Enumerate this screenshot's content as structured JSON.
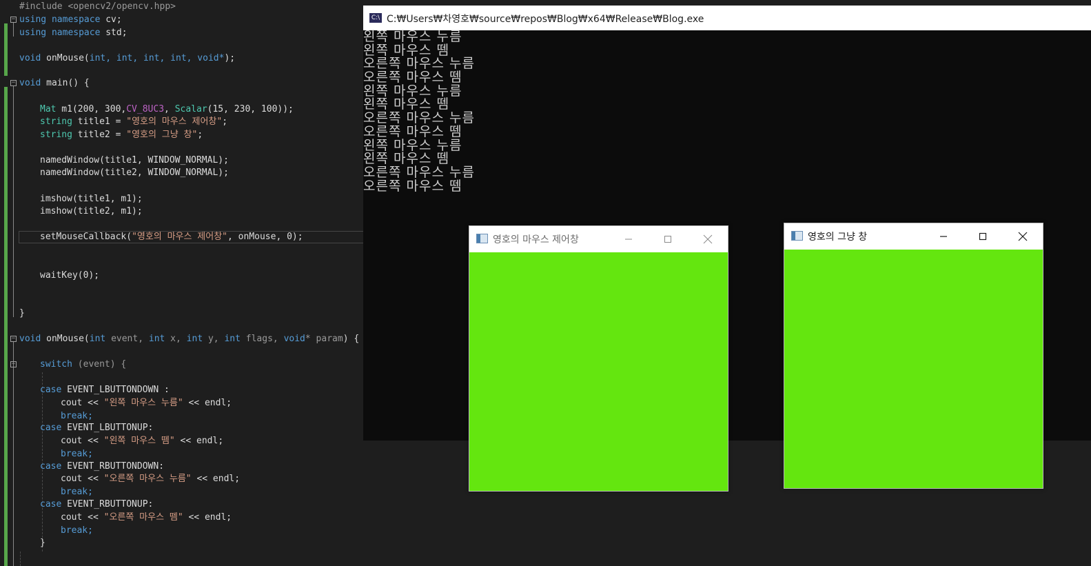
{
  "editor": {
    "lines": {
      "l01": "#include <opencv2/opencv.hpp>",
      "l02_kw": "using namespace",
      "l02_id": " cv;",
      "l03_kw": "using namespace",
      "l03_id": " std;",
      "l05_kw": "void",
      "l05_fn": " onMouse(",
      "l05_params": "int, int, int, int, void*",
      "l05_end": ");",
      "l07_kw": "void",
      "l07_rest": " main() {",
      "l09_ty": "Mat",
      "l09_a": " m1(200, 300,",
      "l09_mac": "CV_8UC3",
      "l09_b": ", ",
      "l09_ty2": "Scalar",
      "l09_c": "(15, 230, 100));",
      "l10_ty": "string",
      "l10_a": " title1 = ",
      "l10_str": "\"영호의 마우스 제어창\"",
      "l10_end": ";",
      "l11_ty": "string",
      "l11_a": " title2 = ",
      "l11_str": "\"영호의 그냥 창\"",
      "l11_end": ";",
      "l13": "namedWindow(title1, WINDOW_NORMAL);",
      "l14": "namedWindow(title2, WINDOW_NORMAL);",
      "l16": "imshow(title1, m1);",
      "l17": "imshow(title2, m1);",
      "l19_a": "setMouseCallback(",
      "l19_str": "\"영호의 마우스 제어창\"",
      "l19_b": ", onMouse, 0);",
      "l22": "waitKey(0);",
      "l25": "}",
      "l27_kw": "void",
      "l27_fn": " onMouse(",
      "l27_k1": "int",
      "l27_p1": " event, ",
      "l27_k2": "int",
      "l27_p2": " x, ",
      "l27_k3": "int",
      "l27_p3": " y, ",
      "l27_k4": "int",
      "l27_p4": " flags, ",
      "l27_k5": "void",
      "l27_p5": "* param",
      "l27_end": ") {",
      "l29_kw": "switch",
      "l29_rest": " (event) {",
      "c1_kw": "case",
      "c1_id": " EVENT_LBUTTONDOWN :",
      "c1_a": "cout << ",
      "c1_str": "\"왼쪽 마우스 누름\"",
      "c1_b": " << endl;",
      "c1_break": "break;",
      "c2_kw": "case",
      "c2_id": " EVENT_LBUTTONUP:",
      "c2_a": "cout << ",
      "c2_str": "\"왼쪽 마우스 뗌\"",
      "c2_b": " << endl;",
      "c2_break": "break;",
      "c3_kw": "case",
      "c3_id": " EVENT_RBUTTONDOWN:",
      "c3_a": "cout << ",
      "c3_str": "\"오른쪽 마우스 누름\"",
      "c3_b": " << endl;",
      "c3_break": "break;",
      "c4_kw": "case",
      "c4_id": " EVENT_RBUTTONUP:",
      "c4_a": "cout << ",
      "c4_str": "\"오른쪽 마우스 뗌\"",
      "c4_b": " << endl;",
      "c4_break": "break;",
      "close": "}"
    }
  },
  "console": {
    "title": "C:₩Users₩차영호₩source₩repos₩Blog₩x64₩Release₩Blog.exe",
    "icon_text": "C:\\",
    "output": [
      "왼쪽 마우스 누름",
      "왼쪽 마우스 뗌",
      "오른쪽 마우스 누름",
      "오른쪽 마우스 뗌",
      "왼쪽 마우스 누름",
      "왼쪽 마우스 뗌",
      "오른쪽 마우스 누름",
      "오른쪽 마우스 뗌",
      "왼쪽 마우스 누름",
      "왼쪽 마우스 뗌",
      "오른쪽 마우스 누름",
      "오른쪽 마우스 뗌"
    ]
  },
  "windows": {
    "control": {
      "title": "영호의 마우스 제어창",
      "title_color": "#6b6b6b",
      "canvas_color": "#64e60f"
    },
    "plain": {
      "title": "영호의 그냥 창",
      "title_color": "#1a1a1a",
      "canvas_color": "#64e60f"
    }
  },
  "icons": [
    "minimize-icon",
    "maximize-icon",
    "close-icon",
    "console-app-icon",
    "opencv-window-icon"
  ]
}
